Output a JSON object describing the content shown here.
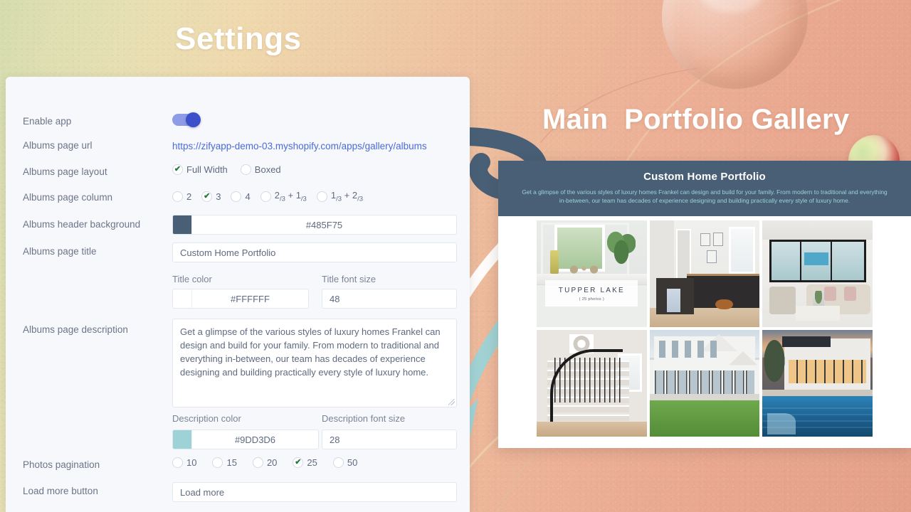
{
  "page": {
    "settings_title": "Settings",
    "preview_section_title": "Main  Portfolio Gallery"
  },
  "settings": {
    "rows": {
      "enable_app": {
        "label": "Enable app",
        "toggle_on": true
      },
      "albums_page_url": {
        "label": "Albums page url",
        "value": "https://zifyapp-demo-03.myshopify.com/apps/gallery/albums"
      },
      "albums_page_layout": {
        "label": "Albums page layout",
        "options": [
          "Full Width",
          "Boxed"
        ],
        "selected": "Full Width"
      },
      "albums_page_column": {
        "label": "Albums page column",
        "options": [
          "2",
          "3",
          "4",
          "2/3 + 1/3",
          "1/3 + 2/3"
        ],
        "selected": "3"
      },
      "albums_header_background": {
        "label": "Albums header background",
        "value": "#485F75",
        "swatch": "#485F75"
      },
      "albums_page_title": {
        "label": "Albums page title",
        "value": "Custom Home Portfolio"
      },
      "title_color": {
        "label": "Title color",
        "value": "#FFFFFF",
        "swatch": "#FFFFFF"
      },
      "title_font_size": {
        "label": "Title font size",
        "value": "48"
      },
      "albums_page_description": {
        "label": "Albums page description",
        "value": " Get a glimpse of the various styles of luxury homes Frankel can design and build for your family. From modern to traditional and everything in-between, our team has decades of experience designing and building practically every style of luxury home."
      },
      "description_color": {
        "label": "Description color",
        "value": "#9DD3D6",
        "swatch": "#9DD3D6"
      },
      "description_font_size": {
        "label": "Description font size",
        "value": "28"
      },
      "photos_pagination": {
        "label": "Photos pagination",
        "options": [
          "10",
          "15",
          "20",
          "25",
          "50"
        ],
        "selected": "25"
      },
      "load_more_button": {
        "label": "Load more button",
        "value": "Load more"
      }
    }
  },
  "preview": {
    "header_title": "Custom Home Portfolio",
    "header_description": "Get a glimpse of the various styles of luxury homes Frankel can design and build for your family. From modern to traditional and everything in-between, our team has decades of experience designing and building practically every style of luxury home.",
    "header_bg": "#485F75",
    "title_color": "#FFFFFF",
    "description_color": "#9DD3D6",
    "album_caption": {
      "name": "TUPPER LAKE",
      "count": "( 25 photos )"
    }
  }
}
